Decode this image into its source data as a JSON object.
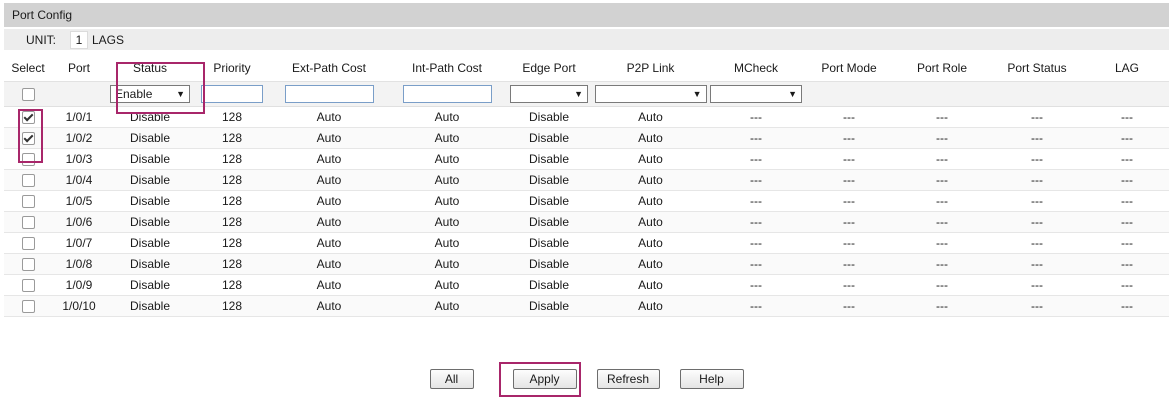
{
  "panel": {
    "title": "Port Config"
  },
  "unit": {
    "label": "UNIT:",
    "number": "1",
    "lags": "LAGS"
  },
  "columns": [
    "Select",
    "Port",
    "Status",
    "Priority",
    "Ext-Path Cost",
    "Int-Path Cost",
    "Edge Port",
    "P2P Link",
    "MCheck",
    "Port Mode",
    "Port Role",
    "Port Status",
    "LAG"
  ],
  "controls": {
    "status_value": "Enable",
    "arrow": "▼"
  },
  "rows": [
    {
      "checked": true,
      "port": "1/0/1",
      "status": "Disable",
      "priority": "128",
      "ext": "Auto",
      "int": "Auto",
      "edge": "Disable",
      "p2p": "Auto",
      "mcheck": "---",
      "mode": "---",
      "role": "---",
      "pstatus": "---",
      "lag": "---"
    },
    {
      "checked": true,
      "port": "1/0/2",
      "status": "Disable",
      "priority": "128",
      "ext": "Auto",
      "int": "Auto",
      "edge": "Disable",
      "p2p": "Auto",
      "mcheck": "---",
      "mode": "---",
      "role": "---",
      "pstatus": "---",
      "lag": "---"
    },
    {
      "checked": false,
      "port": "1/0/3",
      "status": "Disable",
      "priority": "128",
      "ext": "Auto",
      "int": "Auto",
      "edge": "Disable",
      "p2p": "Auto",
      "mcheck": "---",
      "mode": "---",
      "role": "---",
      "pstatus": "---",
      "lag": "---"
    },
    {
      "checked": false,
      "port": "1/0/4",
      "status": "Disable",
      "priority": "128",
      "ext": "Auto",
      "int": "Auto",
      "edge": "Disable",
      "p2p": "Auto",
      "mcheck": "---",
      "mode": "---",
      "role": "---",
      "pstatus": "---",
      "lag": "---"
    },
    {
      "checked": false,
      "port": "1/0/5",
      "status": "Disable",
      "priority": "128",
      "ext": "Auto",
      "int": "Auto",
      "edge": "Disable",
      "p2p": "Auto",
      "mcheck": "---",
      "mode": "---",
      "role": "---",
      "pstatus": "---",
      "lag": "---"
    },
    {
      "checked": false,
      "port": "1/0/6",
      "status": "Disable",
      "priority": "128",
      "ext": "Auto",
      "int": "Auto",
      "edge": "Disable",
      "p2p": "Auto",
      "mcheck": "---",
      "mode": "---",
      "role": "---",
      "pstatus": "---",
      "lag": "---"
    },
    {
      "checked": false,
      "port": "1/0/7",
      "status": "Disable",
      "priority": "128",
      "ext": "Auto",
      "int": "Auto",
      "edge": "Disable",
      "p2p": "Auto",
      "mcheck": "---",
      "mode": "---",
      "role": "---",
      "pstatus": "---",
      "lag": "---"
    },
    {
      "checked": false,
      "port": "1/0/8",
      "status": "Disable",
      "priority": "128",
      "ext": "Auto",
      "int": "Auto",
      "edge": "Disable",
      "p2p": "Auto",
      "mcheck": "---",
      "mode": "---",
      "role": "---",
      "pstatus": "---",
      "lag": "---"
    },
    {
      "checked": false,
      "port": "1/0/9",
      "status": "Disable",
      "priority": "128",
      "ext": "Auto",
      "int": "Auto",
      "edge": "Disable",
      "p2p": "Auto",
      "mcheck": "---",
      "mode": "---",
      "role": "---",
      "pstatus": "---",
      "lag": "---"
    },
    {
      "checked": false,
      "port": "1/0/10",
      "status": "Disable",
      "priority": "128",
      "ext": "Auto",
      "int": "Auto",
      "edge": "Disable",
      "p2p": "Auto",
      "mcheck": "---",
      "mode": "---",
      "role": "---",
      "pstatus": "---",
      "lag": "---"
    }
  ],
  "buttons": {
    "all": "All",
    "apply": "Apply",
    "refresh": "Refresh",
    "help": "Help"
  },
  "colors": {
    "highlight": "#a8266a",
    "titlebar": "#d2d2d2"
  }
}
